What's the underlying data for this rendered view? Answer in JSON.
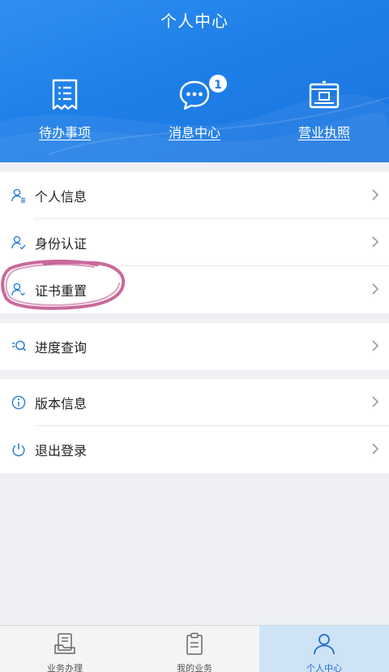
{
  "header": {
    "title": "个人中心",
    "shortcuts": [
      {
        "label": "待办事项",
        "icon": "todo-list-icon"
      },
      {
        "label": "消息中心",
        "icon": "message-bubble-icon",
        "badge": "1"
      },
      {
        "label": "营业执照",
        "icon": "business-license-icon"
      }
    ]
  },
  "menu": {
    "group1": [
      {
        "label": "个人信息",
        "icon": "person-info-icon"
      },
      {
        "label": "身份认证",
        "icon": "person-verify-icon"
      },
      {
        "label": "证书重置",
        "icon": "person-cert-icon"
      }
    ],
    "group2": [
      {
        "label": "进度查询",
        "icon": "progress-search-icon"
      }
    ],
    "group3": [
      {
        "label": "版本信息",
        "icon": "info-icon"
      },
      {
        "label": "退出登录",
        "icon": "power-icon"
      }
    ]
  },
  "tabbar": {
    "tabs": [
      {
        "label": "业务办理",
        "icon": "business-handle-icon"
      },
      {
        "label": "我的业务",
        "icon": "clipboard-icon"
      },
      {
        "label": "个人中心",
        "icon": "user-icon",
        "active": true
      }
    ]
  },
  "colors": {
    "brand_blue": "#1f7fe9",
    "highlight_circle": "#c0508a",
    "active_tab_bg": "#cfe3f7"
  }
}
